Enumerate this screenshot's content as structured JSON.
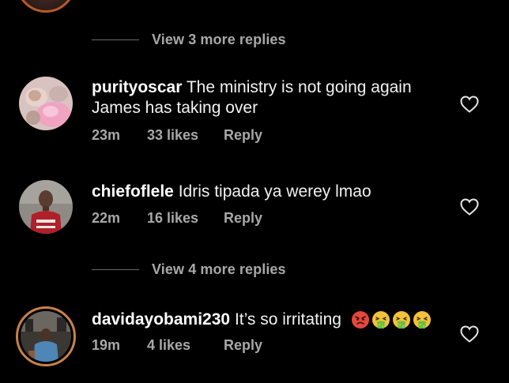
{
  "thread": {
    "view_more_1": "View 3 more replies",
    "view_more_2": "View 4 more replies"
  },
  "comments": [
    {
      "username": "purityoscar",
      "text_line1": "The ministry is not going again",
      "text_line2": "James has taking over",
      "time": "23m",
      "likes": "33 likes",
      "reply": "Reply",
      "avatar_icon": "baby-photo-avatar"
    },
    {
      "username": "chiefoflele",
      "text_line1": "Idris tipada ya werey lmao",
      "time": "22m",
      "likes": "16 likes",
      "reply": "Reply",
      "avatar_icon": "man-red-shirt-avatar"
    },
    {
      "username": "davidayobami230",
      "text_line1": "It’s so irritating",
      "emojis": [
        "angry-face-emoji",
        "vomiting-face-emoji",
        "vomiting-face-emoji",
        "vomiting-face-emoji"
      ],
      "time": "19m",
      "likes": "4 likes",
      "reply": "Reply",
      "avatar_icon": "story-ring-avatar"
    }
  ],
  "icons": {
    "like": "heart-outline-icon"
  },
  "colors": {
    "background": "#000000",
    "primary_text": "#ffffff",
    "secondary_text": "#a8a8a8",
    "story_ring": "#c98248"
  }
}
